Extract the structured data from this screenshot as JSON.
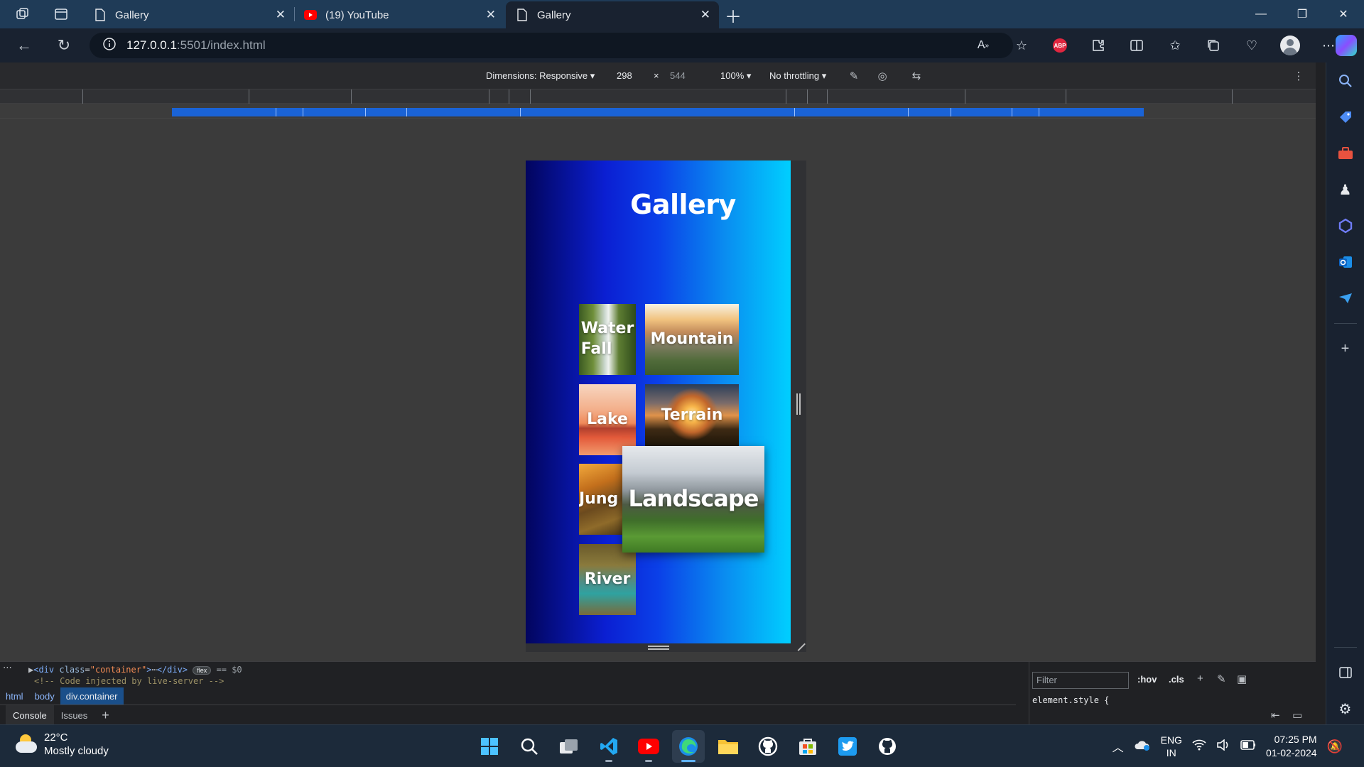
{
  "browser": {
    "tabs": [
      {
        "title": "Gallery",
        "active": false,
        "icon": "page-icon"
      },
      {
        "title": "(19) YouTube",
        "active": false,
        "icon": "youtube-icon"
      },
      {
        "title": "Gallery",
        "active": true,
        "icon": "page-icon"
      }
    ],
    "url_host": "127.0.0.1",
    "url_path": ":5501/index.html",
    "colors": {
      "titlebar": "#1f3b57",
      "toolbar": "#192230",
      "accent": "#1a63d6"
    }
  },
  "device_toolbar": {
    "dimensions_label": "Dimensions: Responsive",
    "width": "298",
    "times": "×",
    "height": "544",
    "zoom": "100%",
    "throttling": "No throttling"
  },
  "page": {
    "title": "Gallery",
    "gradient": [
      "#02055e",
      "#0b1fd2",
      "#00cfff"
    ],
    "cards": [
      {
        "label": "Water Fall",
        "line1": "Water",
        "line2": "Fall"
      },
      {
        "label": "Mountain"
      },
      {
        "label": "Lake"
      },
      {
        "label": "Terrain"
      },
      {
        "label": "Jungle",
        "visible_text": "Jung"
      },
      {
        "label": "Landscape",
        "state": "hover-zoomed"
      },
      {
        "label": "River"
      }
    ]
  },
  "devtools": {
    "dom_line_tag": "<div",
    "dom_line_attr": "class",
    "dom_line_value": "\"container\"",
    "dom_line_close": "</div>",
    "dom_badge": "flex",
    "dom_selected": "== $0",
    "comment": "<!-- Code injected by live-server -->",
    "breadcrumbs": [
      "html",
      "body",
      "div.container"
    ],
    "drawer_tabs": [
      "Console",
      "Issues"
    ],
    "filter_placeholder": "Filter",
    "hov": ":hov",
    "cls": ".cls",
    "element_style": "element.style {"
  },
  "taskbar": {
    "temperature": "22°C",
    "weather": "Mostly cloudy",
    "lang_top": "ENG",
    "lang_bottom": "IN",
    "time": "07:25 PM",
    "date": "01-02-2024"
  }
}
